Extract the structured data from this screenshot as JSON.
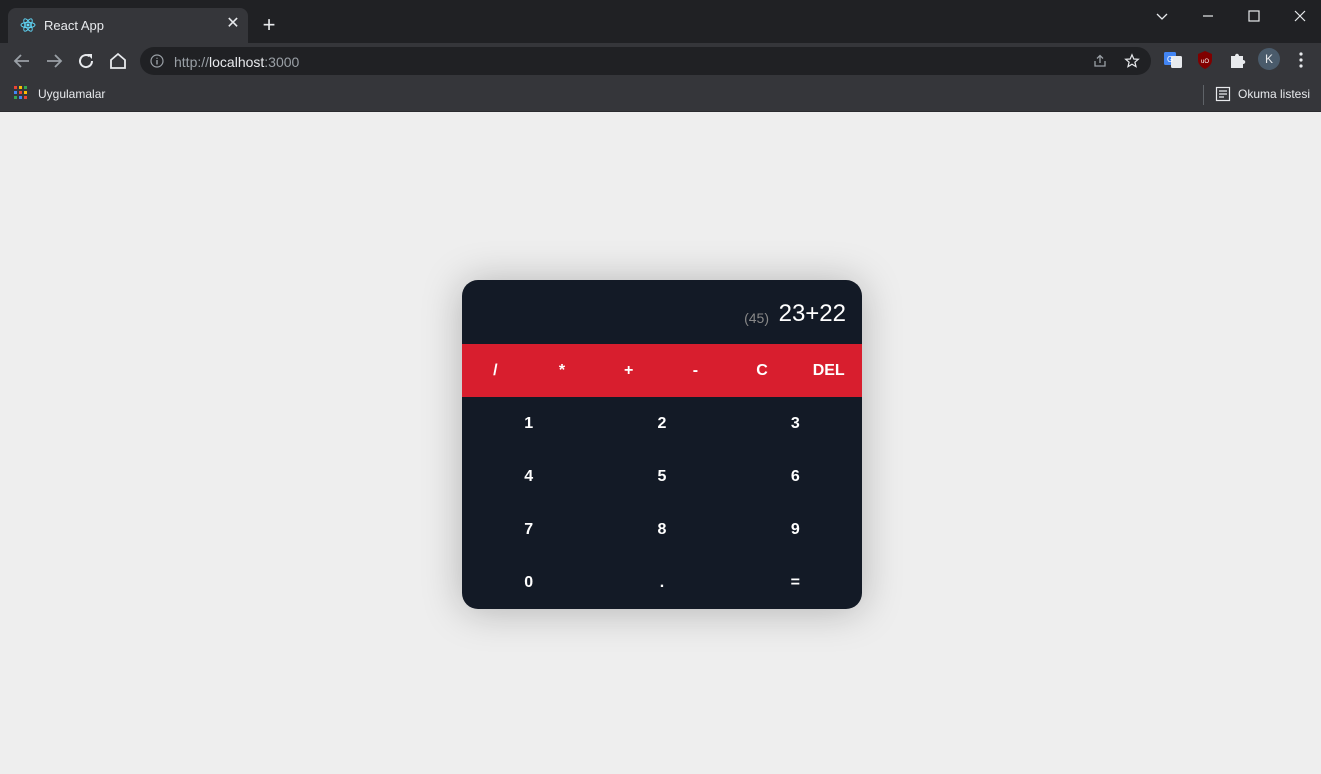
{
  "browser": {
    "tab_title": "React App",
    "url_scheme": "http://",
    "url_host": "localhost",
    "url_port": ":3000",
    "profile_initial": "K",
    "bookmarks": {
      "apps_label": "Uygulamalar",
      "reading_list_label": "Okuma listesi"
    },
    "icons": [
      "react-icon",
      "close-icon",
      "plus-icon",
      "chevron-down-icon",
      "minimize-icon",
      "maximize-icon",
      "window-close-icon",
      "back-icon",
      "forward-icon",
      "reload-icon",
      "home-icon",
      "info-icon",
      "share-icon",
      "star-icon",
      "translate-icon",
      "ublock-icon",
      "puzzle-icon",
      "menu-icon",
      "apps-grid-icon",
      "reading-list-icon"
    ]
  },
  "calculator": {
    "result_preview": "(45)",
    "expression": "23+22",
    "operators": [
      "/",
      "*",
      "+",
      "-",
      "C",
      "DEL"
    ],
    "digits": [
      "1",
      "2",
      "3",
      "4",
      "5",
      "6",
      "7",
      "8",
      "9",
      "0",
      ".",
      "="
    ],
    "colors": {
      "background": "#131a26",
      "operator_bar": "#d81e2e",
      "page": "#eeeeee"
    }
  }
}
